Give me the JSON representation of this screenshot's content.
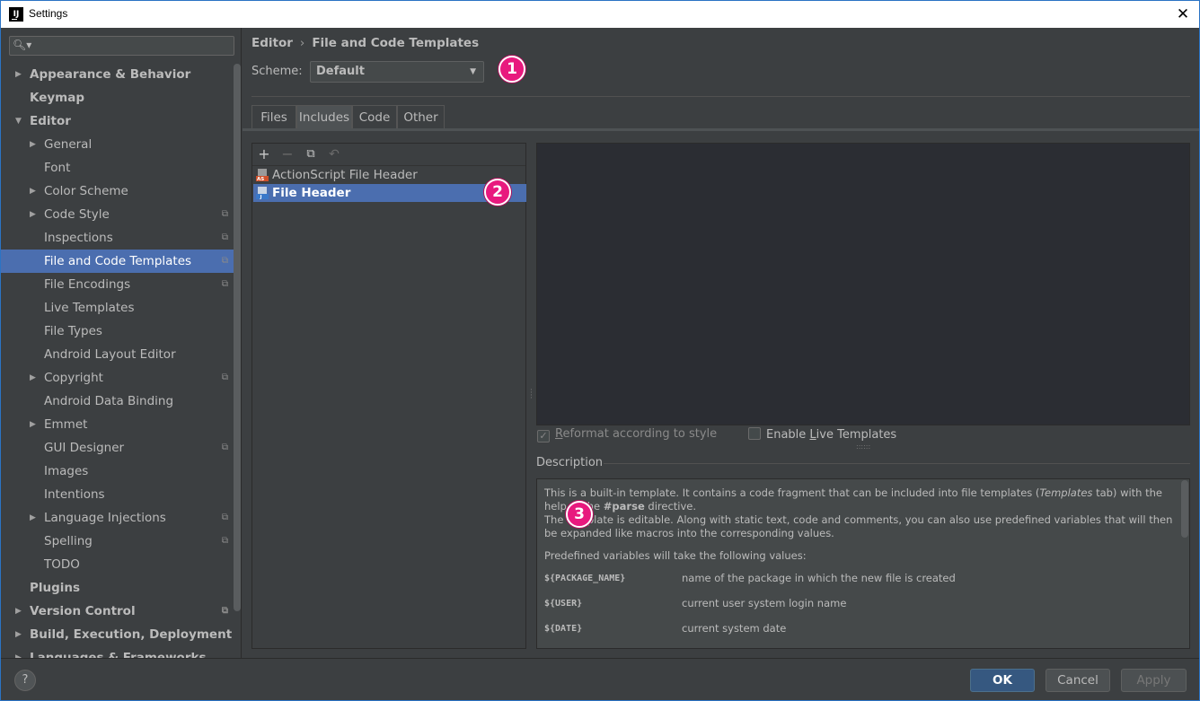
{
  "window": {
    "title": "Settings"
  },
  "search": {
    "placeholder": ""
  },
  "sidebar": {
    "items": [
      {
        "label": "Appearance & Behavior",
        "level": 0,
        "arrow": "right",
        "copy": false
      },
      {
        "label": "Keymap",
        "level": 0,
        "arrow": "",
        "copy": false
      },
      {
        "label": "Editor",
        "level": 0,
        "arrow": "down",
        "copy": false
      },
      {
        "label": "General",
        "level": 1,
        "arrow": "right",
        "copy": false
      },
      {
        "label": "Font",
        "level": 1,
        "arrow": "",
        "copy": false
      },
      {
        "label": "Color Scheme",
        "level": 1,
        "arrow": "right",
        "copy": false
      },
      {
        "label": "Code Style",
        "level": 1,
        "arrow": "right",
        "copy": true
      },
      {
        "label": "Inspections",
        "level": 1,
        "arrow": "",
        "copy": true
      },
      {
        "label": "File and Code Templates",
        "level": 1,
        "arrow": "",
        "copy": true,
        "selected": true
      },
      {
        "label": "File Encodings",
        "level": 1,
        "arrow": "",
        "copy": true
      },
      {
        "label": "Live Templates",
        "level": 1,
        "arrow": "",
        "copy": false
      },
      {
        "label": "File Types",
        "level": 1,
        "arrow": "",
        "copy": false
      },
      {
        "label": "Android Layout Editor",
        "level": 1,
        "arrow": "",
        "copy": false
      },
      {
        "label": "Copyright",
        "level": 1,
        "arrow": "right",
        "copy": true
      },
      {
        "label": "Android Data Binding",
        "level": 1,
        "arrow": "",
        "copy": false
      },
      {
        "label": "Emmet",
        "level": 1,
        "arrow": "right",
        "copy": false
      },
      {
        "label": "GUI Designer",
        "level": 1,
        "arrow": "",
        "copy": true
      },
      {
        "label": "Images",
        "level": 1,
        "arrow": "",
        "copy": false
      },
      {
        "label": "Intentions",
        "level": 1,
        "arrow": "",
        "copy": false
      },
      {
        "label": "Language Injections",
        "level": 1,
        "arrow": "right",
        "copy": true
      },
      {
        "label": "Spelling",
        "level": 1,
        "arrow": "",
        "copy": true
      },
      {
        "label": "TODO",
        "level": 1,
        "arrow": "",
        "copy": false
      },
      {
        "label": "Plugins",
        "level": 0,
        "arrow": "",
        "copy": false
      },
      {
        "label": "Version Control",
        "level": 0,
        "arrow": "right",
        "copy": true
      },
      {
        "label": "Build, Execution, Deployment",
        "level": 0,
        "arrow": "right",
        "copy": false
      },
      {
        "label": "Languages & Frameworks",
        "level": 0,
        "arrow": "right",
        "copy": false
      }
    ]
  },
  "breadcrumb": {
    "parent": "Editor",
    "separator": "›",
    "current": "File and Code Templates"
  },
  "scheme": {
    "label": "Scheme:",
    "value": "Default"
  },
  "callouts": {
    "one": "1",
    "two": "2",
    "three": "3"
  },
  "tabs": [
    "Files",
    "Includes",
    "Code",
    "Other"
  ],
  "active_tab": "Includes",
  "toolbar": {
    "add": "+",
    "remove": "−",
    "copy": "⧉",
    "reset": "↶"
  },
  "templates": [
    {
      "label": "ActionScript File Header",
      "icon": "actionscript-file-icon"
    },
    {
      "label": "File Header",
      "icon": "java-file-icon",
      "selected": true
    }
  ],
  "options": {
    "reformat": {
      "label_pre": "",
      "label_u": "R",
      "label_post": "eformat according to style",
      "checked": true,
      "enabled": false
    },
    "live": {
      "label_pre": "Enable ",
      "label_u": "L",
      "label_post": "ive Templates",
      "checked": false,
      "enabled": true
    }
  },
  "description": {
    "label": "Description",
    "p1_pre": "This is a built-in template. It contains a code fragment that can be included into file templates (",
    "p1_em": "Templates",
    "p1_mid": " tab) with the help of the ",
    "p1_bold": "#parse",
    "p1_post": " directive.",
    "p1b": "The template is editable. Along with static text, code and comments, you can also use predefined variables that will then be expanded like macros into the corresponding values.",
    "p2": "Predefined variables will take the following values:",
    "vars": [
      {
        "name": "${PACKAGE_NAME}",
        "desc": "name of the package in which the new file is created"
      },
      {
        "name": "${USER}",
        "desc": "current user system login name"
      },
      {
        "name": "${DATE}",
        "desc": "current system date"
      }
    ]
  },
  "buttons": {
    "help": "?",
    "ok": "OK",
    "cancel": "Cancel",
    "apply": "Apply"
  },
  "colors": {
    "selection": "#4b6eaf",
    "callout": "#e8197e",
    "ok": "#365880"
  }
}
